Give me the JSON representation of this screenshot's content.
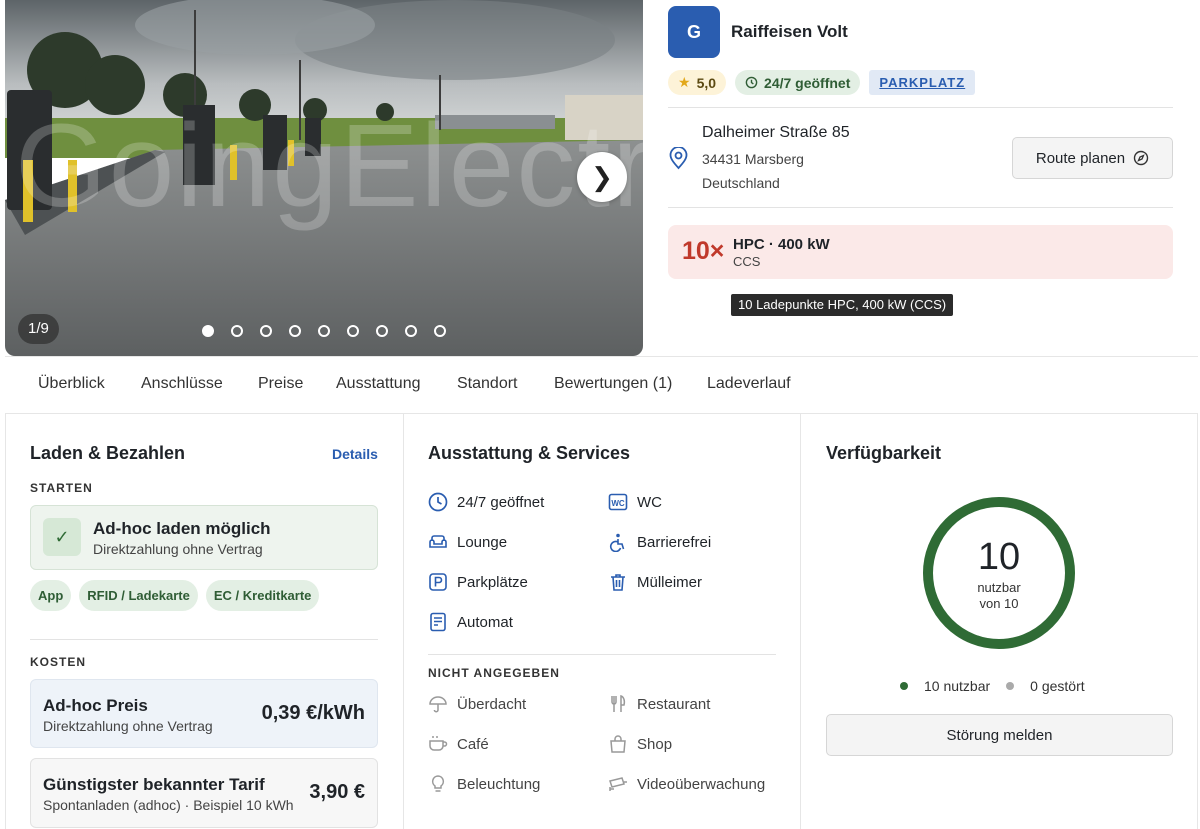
{
  "gallery": {
    "watermark": "GoingElectric",
    "counter": "1/9",
    "slide_count": 9,
    "active_slide": 1,
    "next_icon": "chevron-right-icon",
    "next_label": "❯"
  },
  "station": {
    "logo_letter": "G",
    "logo_color": "#2a5db0",
    "name": "Raiffeisen Volt",
    "rating": "5,0",
    "opening": "24/7 geöffnet",
    "type_badge": "PARKPLATZ",
    "address": {
      "street": "Dalheimer Straße 85",
      "city": "34431 Marsberg",
      "country": "Deutschland"
    },
    "route_button": "Route planen"
  },
  "charging": {
    "count": "10×",
    "title": "HPC · 400 kW",
    "connector": "CCS",
    "tooltip": "10 Ladepunkte HPC, 400 kW (CCS)",
    "accent_color": "#c0392b"
  },
  "tabs": [
    "Überblick",
    "Anschlüsse",
    "Preise",
    "Ausstattung",
    "Standort",
    "Bewertungen (1)",
    "Ladeverlauf"
  ],
  "payment": {
    "title": "Laden & Bezahlen",
    "details_link": "Details",
    "start_label": "STARTEN",
    "adhoc_title": "Ad-hoc laden möglich",
    "adhoc_sub": "Direktzahlung ohne Vertrag",
    "methods": [
      "App",
      "RFID / Ladekarte",
      "EC / Kreditkarte"
    ],
    "cost_label": "KOSTEN",
    "price_title": "Ad-hoc Preis",
    "price_sub": "Direktzahlung ohne Vertrag",
    "price_value": "0,39 €/kWh",
    "tariff_title": "Günstigster bekannter Tarif",
    "tariff_sub": "Spontanladen (adhoc) · Beispiel 10 kWh",
    "tariff_value": "3,90 €"
  },
  "amenities": {
    "title": "Ausstattung & Services",
    "available": [
      {
        "label": "24/7 geöffnet",
        "icon": "clock-icon"
      },
      {
        "label": "WC",
        "icon": "wc-icon"
      },
      {
        "label": "Lounge",
        "icon": "sofa-icon"
      },
      {
        "label": "Barrierefrei",
        "icon": "accessibility-icon"
      },
      {
        "label": "Parkplätze",
        "icon": "parking-icon"
      },
      {
        "label": "Mülleimer",
        "icon": "trash-icon"
      },
      {
        "label": "Automat",
        "icon": "vending-machine-icon"
      }
    ],
    "unknown_label": "NICHT ANGEGEBEN",
    "unknown": [
      {
        "label": "Überdacht",
        "icon": "umbrella-icon"
      },
      {
        "label": "Restaurant",
        "icon": "cutlery-icon"
      },
      {
        "label": "Café",
        "icon": "coffee-cup-icon"
      },
      {
        "label": "Shop",
        "icon": "shopping-bag-icon"
      },
      {
        "label": "Beleuchtung",
        "icon": "lightbulb-icon"
      },
      {
        "label": "Videoüberwachung",
        "icon": "cctv-camera-icon"
      }
    ]
  },
  "availability": {
    "title": "Verfügbarkeit",
    "usable": "10",
    "usable_label": "nutzbar",
    "total_label": "von 10",
    "usable_fraction": 1.0,
    "legend_usable": "10 nutzbar",
    "legend_broken": "0 gestört",
    "usable_color": "#2f6b35",
    "broken_color": "#aaaaaa",
    "report_button": "Störung melden"
  }
}
